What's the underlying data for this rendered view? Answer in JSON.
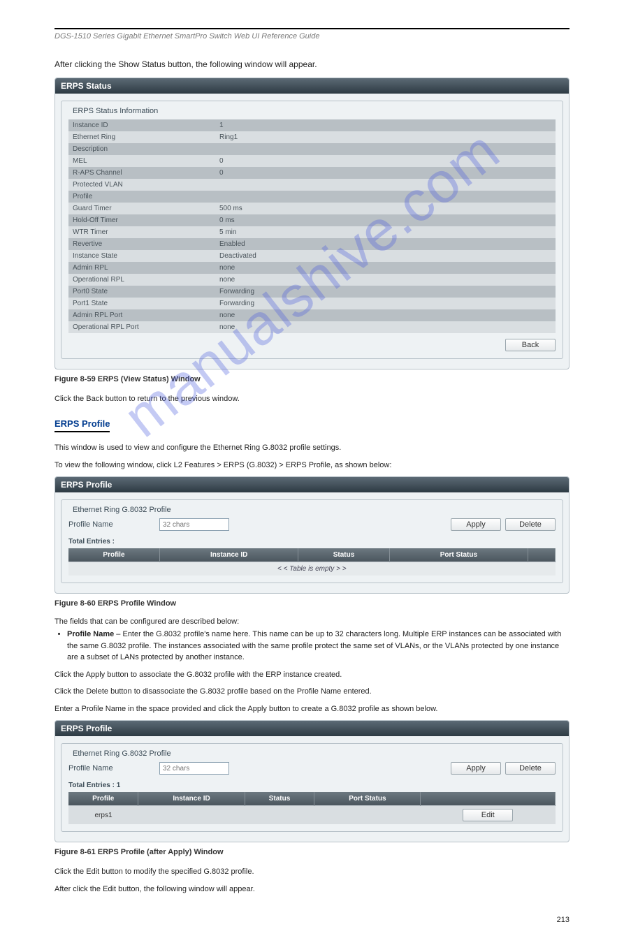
{
  "watermark": "manualshive.com",
  "header": {
    "left": "DGS-1510 Series Gigabit Ethernet SmartPro Switch Web UI Reference Guide",
    "right": ""
  },
  "intro": "After clicking the Show Status button, the following window will appear.",
  "panel1": {
    "title": "ERPS Status",
    "fieldset_title": "ERPS Status Information",
    "rows": [
      {
        "label": "Instance ID",
        "value": "1"
      },
      {
        "label": "Ethernet Ring",
        "value": "Ring1"
      },
      {
        "label": "Description",
        "value": ""
      },
      {
        "label": "MEL",
        "value": "0"
      },
      {
        "label": "R-APS Channel",
        "value": "0"
      },
      {
        "label": "Protected VLAN",
        "value": ""
      },
      {
        "label": "Profile",
        "value": ""
      },
      {
        "label": "Guard Timer",
        "value": "500 ms"
      },
      {
        "label": "Hold-Off Timer",
        "value": "0 ms"
      },
      {
        "label": "WTR Timer",
        "value": "5 min"
      },
      {
        "label": "Revertive",
        "value": "Enabled"
      },
      {
        "label": "Instance State",
        "value": "Deactivated"
      },
      {
        "label": "Admin RPL",
        "value": "none"
      },
      {
        "label": "Operational RPL",
        "value": "none"
      },
      {
        "label": "Port0 State",
        "value": "Forwarding"
      },
      {
        "label": "Port1 State",
        "value": "Forwarding"
      },
      {
        "label": "Admin RPL Port",
        "value": "none"
      },
      {
        "label": "Operational RPL Port",
        "value": "none"
      }
    ],
    "back_btn": "Back"
  },
  "figure1_caption": "Figure 8-59 ERPS (View Status) Window",
  "back_note": "Click the Back button to return to the previous window.",
  "subheading": "ERPS Profile",
  "subheading_intro": "This window is used to view and configure the Ethernet Ring G.8032 profile settings.",
  "nav_text": "To view the following window, click L2 Features > ERPS (G.8032) > ERPS Profile, as shown below:",
  "panel2": {
    "title": "ERPS Profile",
    "fieldset_title": "Ethernet Ring G.8032 Profile",
    "profile_label": "Profile Name",
    "placeholder": "32 chars",
    "apply_btn": "Apply",
    "delete_btn": "Delete",
    "total_entries": "Total Entries :",
    "columns": [
      "Profile",
      "Instance ID",
      "Status",
      "Port Status",
      ""
    ],
    "empty_msg": "< < Table is empty > >"
  },
  "figure2_caption": "Figure 8-60 ERPS Profile Window",
  "params_heading": "The fields that can be configured are described below:",
  "params": [
    {
      "bold": "Profile Name",
      "text": " – Enter the G.8032 profile's name here. This name can be up to 32 characters long. Multiple ERP instances can be associated with the same G.8032 profile. The instances associated with the same profile protect the same set of VLANs, or the VLANs protected by one instance are a subset of LANs protected by another instance."
    }
  ],
  "apply_note": "Click the Apply button to associate the G.8032 profile with the ERP instance created.",
  "delete_note": "Click the Delete button to disassociate the G.8032 profile based on the Profile Name entered.",
  "create_note": "Enter a Profile Name in the space provided and click the Apply button to create a G.8032 profile as shown below.",
  "panel3": {
    "title": "ERPS Profile",
    "fieldset_title": "Ethernet Ring G.8032 Profile",
    "profile_label": "Profile Name",
    "placeholder": "32 chars",
    "apply_btn": "Apply",
    "delete_btn": "Delete",
    "total_entries": "Total Entries : 1",
    "columns": [
      "Profile",
      "Instance ID",
      "Status",
      "Port Status",
      ""
    ],
    "row": {
      "profile": "erps1",
      "instance": "",
      "status": "",
      "port_status": "",
      "edit_btn": "Edit"
    }
  },
  "figure3_caption": "Figure 8-61 ERPS Profile (after Apply) Window",
  "edit_note": "Click the Edit button to modify the specified G.8032 profile.",
  "after_edit_note": "After click the Edit button, the following window will appear.",
  "page_number": "213"
}
